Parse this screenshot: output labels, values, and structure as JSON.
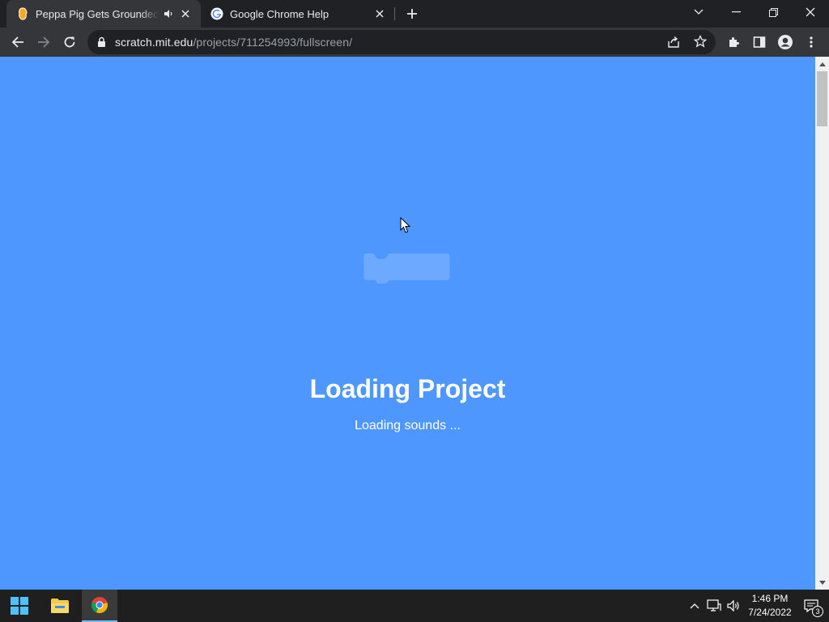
{
  "browser": {
    "tabs": [
      {
        "title": "Peppa Pig Gets Grounded Scratch",
        "active": true,
        "audio": true
      },
      {
        "title": "Google Chrome Help",
        "active": false,
        "audio": false
      }
    ],
    "new_tab": "+",
    "url": {
      "host": "scratch.mit.edu",
      "path": "/projects/711254993/fullscreen/"
    }
  },
  "page": {
    "title": "Loading Project",
    "status": "Loading sounds ...",
    "background": "#4d97ff"
  },
  "taskbar": {
    "time": "1:46 PM",
    "date": "7/24/2022",
    "notification_count": "3"
  },
  "colors": {
    "chrome_dark": "#202124",
    "chrome_toolbar": "#35363a",
    "scratch_blue": "#4d97ff",
    "chrome_red": "#db4437",
    "chrome_green": "#0f9d58",
    "chrome_yellow": "#f4b400",
    "chrome_blue": "#4285f4"
  }
}
